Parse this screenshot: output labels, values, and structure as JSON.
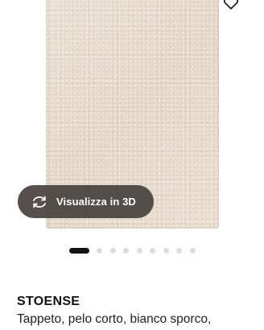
{
  "gallery": {
    "view_3d_label": "Visualizza in 3D",
    "view_3d_icon": "rotate-arrows-icon",
    "favorite_icon": "heart-icon",
    "dots": {
      "total": 9,
      "active_index": 0
    }
  },
  "product": {
    "name": "STOENSE",
    "description": "Tappeto, pelo corto, bianco sporco,"
  },
  "colors": {
    "rug": "#e6dacb",
    "button_bg": "#46413e",
    "dot_active": "#111111",
    "dot_inactive": "#dcdcdc"
  }
}
